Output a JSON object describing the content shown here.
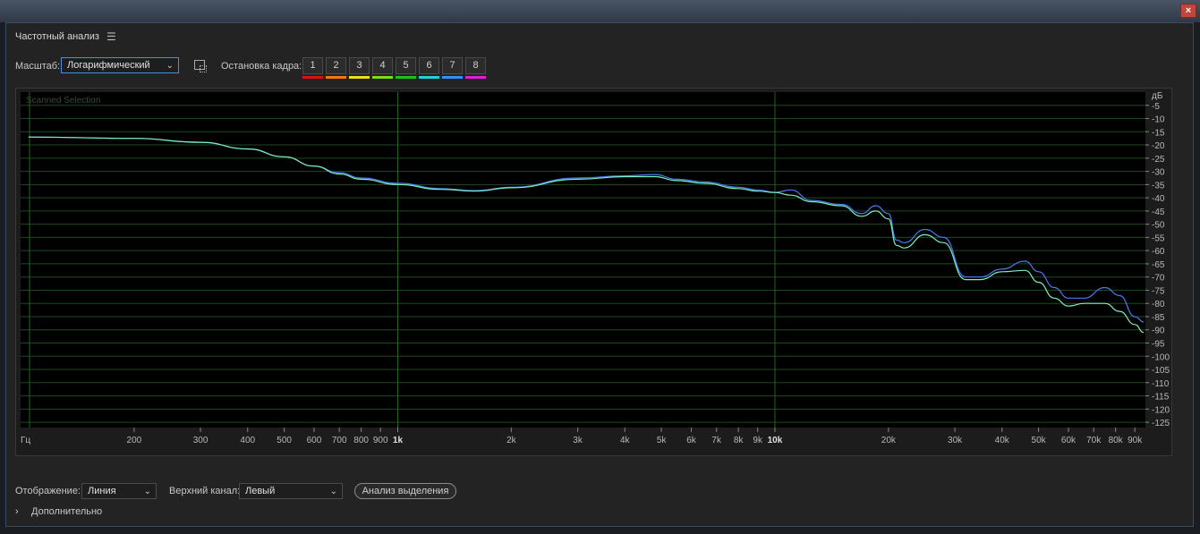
{
  "window": {
    "close_glyph": "×"
  },
  "panel": {
    "title": "Частотный анализ",
    "menu_icon": "menu-icon"
  },
  "toolbar": {
    "scale_label": "Масштаб:",
    "scale_value": "Логарифмический",
    "hold_label": "Остановка кадра:",
    "hold_buttons": [
      "1",
      "2",
      "3",
      "4",
      "5",
      "6",
      "7",
      "8"
    ],
    "hold_colors": [
      "#e01010",
      "#f07a10",
      "#f0e010",
      "#7be010",
      "#20c020",
      "#20d0e0",
      "#3a8cf0",
      "#e020d0"
    ]
  },
  "graph": {
    "overlay_text": "Scanned Selection",
    "db_unit": "дБ",
    "hz_unit": "Гц",
    "db_ticks": [
      "-5",
      "-10",
      "-15",
      "-20",
      "-25",
      "-30",
      "-35",
      "-40",
      "-45",
      "-50",
      "-55",
      "-60",
      "-65",
      "-70",
      "-75",
      "-80",
      "-85",
      "-90",
      "-95",
      "-100",
      "-105",
      "-110",
      "-115",
      "-120",
      "-125"
    ],
    "freq_ticks": [
      {
        "label": "200",
        "hz": 200
      },
      {
        "label": "300",
        "hz": 300
      },
      {
        "label": "400",
        "hz": 400
      },
      {
        "label": "500",
        "hz": 500
      },
      {
        "label": "600",
        "hz": 600
      },
      {
        "label": "700",
        "hz": 700
      },
      {
        "label": "800",
        "hz": 800
      },
      {
        "label": "900",
        "hz": 900
      },
      {
        "label": "1k",
        "hz": 1000,
        "major": true
      },
      {
        "label": "2k",
        "hz": 2000
      },
      {
        "label": "3k",
        "hz": 3000
      },
      {
        "label": "4k",
        "hz": 4000
      },
      {
        "label": "5k",
        "hz": 5000
      },
      {
        "label": "6k",
        "hz": 6000
      },
      {
        "label": "7k",
        "hz": 7000
      },
      {
        "label": "8k",
        "hz": 8000
      },
      {
        "label": "9k",
        "hz": 9000
      },
      {
        "label": "10k",
        "hz": 10000,
        "major": true
      },
      {
        "label": "20k",
        "hz": 20000
      },
      {
        "label": "30k",
        "hz": 30000
      },
      {
        "label": "40k",
        "hz": 40000
      },
      {
        "label": "50k",
        "hz": 50000
      },
      {
        "label": "60k",
        "hz": 60000
      },
      {
        "label": "70k",
        "hz": 70000
      },
      {
        "label": "80k",
        "hz": 80000
      },
      {
        "label": "90k",
        "hz": 90000
      }
    ],
    "grid_color": "#1f4a1f",
    "bg_color": "#000000"
  },
  "chart_data": {
    "type": "line",
    "x_scale": "log",
    "xlim_hz": [
      100,
      96000
    ],
    "ylim_db": [
      -127,
      0
    ],
    "series": [
      {
        "color": "#4a7cf0",
        "points": [
          [
            105,
            -17
          ],
          [
            200,
            -17.5
          ],
          [
            300,
            -19
          ],
          [
            400,
            -21.5
          ],
          [
            500,
            -24.5
          ],
          [
            600,
            -28
          ],
          [
            700,
            -30.5
          ],
          [
            800,
            -32.5
          ],
          [
            1000,
            -34.5
          ],
          [
            1300,
            -36.5
          ],
          [
            1600,
            -37.3
          ],
          [
            2000,
            -36
          ],
          [
            3000,
            -32.5
          ],
          [
            4000,
            -31.7
          ],
          [
            4800,
            -31.2
          ],
          [
            5500,
            -33
          ],
          [
            6500,
            -34
          ],
          [
            8000,
            -36
          ],
          [
            9000,
            -37
          ],
          [
            10000,
            -38
          ],
          [
            11000,
            -37
          ],
          [
            12500,
            -41
          ],
          [
            15000,
            -42.5
          ],
          [
            17000,
            -46
          ],
          [
            18500,
            -43
          ],
          [
            20000,
            -46
          ],
          [
            21000,
            -56
          ],
          [
            22000,
            -57
          ],
          [
            25000,
            -52
          ],
          [
            28000,
            -55
          ],
          [
            32000,
            -70
          ],
          [
            35000,
            -70
          ],
          [
            40000,
            -67
          ],
          [
            46000,
            -64
          ],
          [
            50000,
            -68
          ],
          [
            55000,
            -74
          ],
          [
            60000,
            -78
          ],
          [
            66000,
            -78
          ],
          [
            75000,
            -74
          ],
          [
            82000,
            -77
          ],
          [
            90000,
            -85
          ],
          [
            95000,
            -87
          ]
        ]
      },
      {
        "color": "#7cf0c0",
        "points": [
          [
            105,
            -17
          ],
          [
            200,
            -17.5
          ],
          [
            300,
            -19
          ],
          [
            400,
            -21.5
          ],
          [
            500,
            -24.5
          ],
          [
            600,
            -28
          ],
          [
            700,
            -31
          ],
          [
            800,
            -33
          ],
          [
            1000,
            -35
          ],
          [
            1300,
            -36.8
          ],
          [
            1600,
            -37.5
          ],
          [
            2000,
            -36.2
          ],
          [
            3000,
            -33
          ],
          [
            4000,
            -32
          ],
          [
            4800,
            -32
          ],
          [
            5500,
            -33.5
          ],
          [
            6500,
            -34.5
          ],
          [
            8000,
            -36.5
          ],
          [
            9000,
            -37.5
          ],
          [
            10000,
            -38
          ],
          [
            11000,
            -39
          ],
          [
            12500,
            -41.5
          ],
          [
            15000,
            -43
          ],
          [
            17000,
            -47
          ],
          [
            18500,
            -45
          ],
          [
            20000,
            -48
          ],
          [
            21000,
            -58
          ],
          [
            22000,
            -59
          ],
          [
            25000,
            -54
          ],
          [
            28000,
            -57
          ],
          [
            32000,
            -71
          ],
          [
            35000,
            -71
          ],
          [
            40000,
            -68
          ],
          [
            46000,
            -67.5
          ],
          [
            50000,
            -72
          ],
          [
            55000,
            -78
          ],
          [
            60000,
            -81
          ],
          [
            66000,
            -80
          ],
          [
            75000,
            -80
          ],
          [
            82000,
            -83
          ],
          [
            90000,
            -88
          ],
          [
            95000,
            -91
          ]
        ]
      }
    ]
  },
  "bottom": {
    "display_label": "Отображение:",
    "display_value": "Линия",
    "channel_label": "Верхний канал:",
    "channel_value": "Левый",
    "analyze_button": "Анализ выделения",
    "more_label": "Дополнительно",
    "more_chevron": "›"
  }
}
